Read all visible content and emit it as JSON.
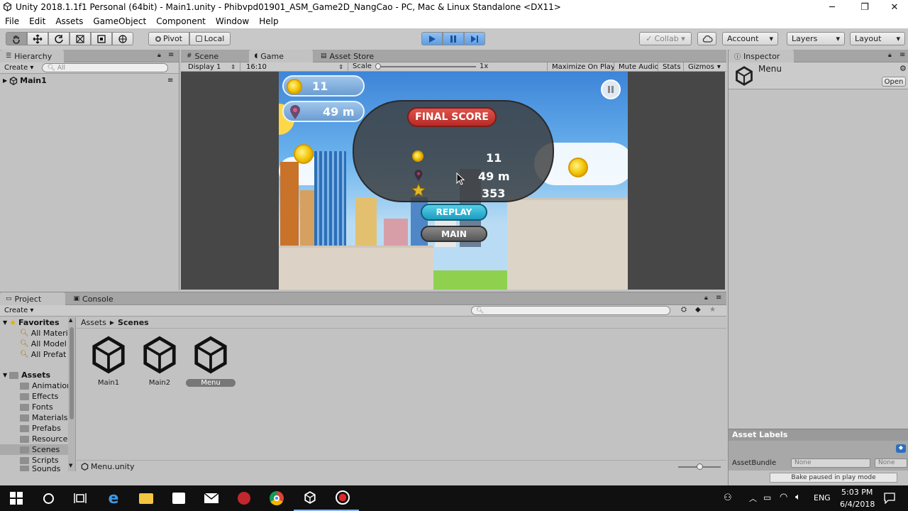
{
  "window": {
    "title": "Unity 2018.1.1f1 Personal (64bit) - Main1.unity - Phibvpd01901_ASM_Game2D_NangCao - PC, Mac & Linux Standalone <DX11>",
    "minimize": "─",
    "maximize": "❐",
    "close": "✕"
  },
  "menu": [
    "File",
    "Edit",
    "Assets",
    "GameObject",
    "Component",
    "Window",
    "Help"
  ],
  "toolbar": {
    "pivot": "Pivot",
    "local": "Local",
    "collab": "Collab ▾",
    "account": "Account",
    "layers": "Layers",
    "layout": "Layout",
    "play_active": true
  },
  "hierarchy": {
    "tab": "Hierarchy",
    "create": "Create ▾",
    "search_placeholder": "All",
    "scene": "Main1"
  },
  "center_tabs": [
    "Scene",
    "Game",
    "Asset Store"
  ],
  "game_toolbar": {
    "display": "Display 1",
    "aspect": "16:10",
    "scale_label": "Scale",
    "scale_value": "1x",
    "maximize": "Maximize On Play",
    "mute": "Mute Audio",
    "stats": "Stats",
    "gizmos": "Gizmos"
  },
  "game": {
    "hud_coins": "11",
    "hud_distance": "49 m",
    "final_score_title": "FINAL SCORE",
    "score_coins": "11",
    "score_distance": "49 m",
    "score_total": "353",
    "replay": "REPLAY",
    "main": "MAIN"
  },
  "inspector": {
    "tab": "Inspector",
    "object": "Menu",
    "open": "Open",
    "asset_labels": "Asset Labels",
    "asset_bundle": "AssetBundle",
    "none1": "None",
    "none2": "None",
    "bake_status": "Bake paused in play mode"
  },
  "project": {
    "tabs": [
      "Project",
      "Console"
    ],
    "create": "Create ▾",
    "favorites": "Favorites",
    "favorite_items": [
      "All Materi",
      "All Model",
      "All Prefat"
    ],
    "assets_root": "Assets",
    "folders": [
      "Animation",
      "Effects",
      "Fonts",
      "Materials",
      "Prefabs",
      "Resource",
      "Scenes",
      "Scripts",
      "Sounds"
    ],
    "selected_folder": "Scenes",
    "breadcrumb": [
      "Assets",
      "Scenes"
    ],
    "items": [
      "Main1",
      "Main2",
      "Menu"
    ],
    "selected_item": "Menu",
    "footer_file": "Menu.unity"
  },
  "taskbar": {
    "time": "5:03 PM",
    "date": "6/4/2018",
    "lang": "ENG"
  },
  "colors": {
    "play_blue": "#5f9de0",
    "panel_gray": "#c2c2c2",
    "final_score_red": "#c8322e",
    "replay_cyan": "#29b2d6",
    "taskbar": "#101010"
  }
}
